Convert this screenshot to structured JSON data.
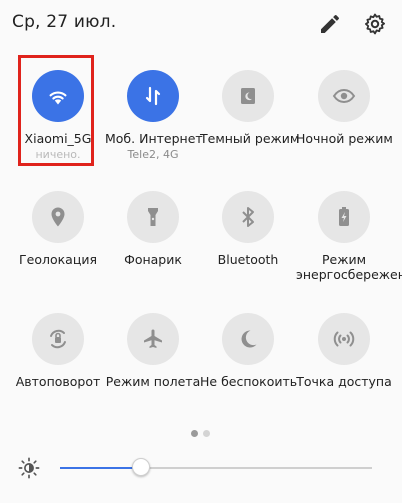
{
  "header": {
    "date": "Ср, 27 июл.",
    "edit_icon": "pencil-icon",
    "settings_icon": "gear-icon"
  },
  "tiles": [
    {
      "label": "Xiaomi_5G",
      "sub": "ничено.",
      "icon": "wifi-icon",
      "active": true
    },
    {
      "label": "Моб. Интернет",
      "sub": "Tele2, 4G",
      "icon": "mobile-data-icon",
      "active": true
    },
    {
      "label": "Темный режим",
      "icon": "dark-mode-icon",
      "active": false
    },
    {
      "label": "Ночной режим",
      "icon": "eye-icon",
      "active": false
    },
    {
      "label": "Геолокация",
      "icon": "location-icon",
      "active": false
    },
    {
      "label": "Фонарик",
      "icon": "flashlight-icon",
      "active": false
    },
    {
      "label": "Bluetooth",
      "icon": "bluetooth-icon",
      "active": false
    },
    {
      "label": "Режим энергосбережения",
      "icon": "battery-saver-icon",
      "active": false
    },
    {
      "label": "Автоповорот",
      "icon": "auto-rotate-icon",
      "active": false
    },
    {
      "label": "Режим полета",
      "icon": "airplane-icon",
      "active": false
    },
    {
      "label": "Не беспокоить",
      "icon": "moon-icon",
      "active": false
    },
    {
      "label": "Точка доступа",
      "icon": "hotspot-icon",
      "active": false
    }
  ],
  "pager": {
    "pages": 2,
    "current": 1
  },
  "brightness": {
    "icon": "brightness-icon",
    "level": 0.26
  },
  "colors": {
    "accent": "#3b73e6",
    "tile_off": "#e6e6e6",
    "highlight": "#e0231c"
  }
}
